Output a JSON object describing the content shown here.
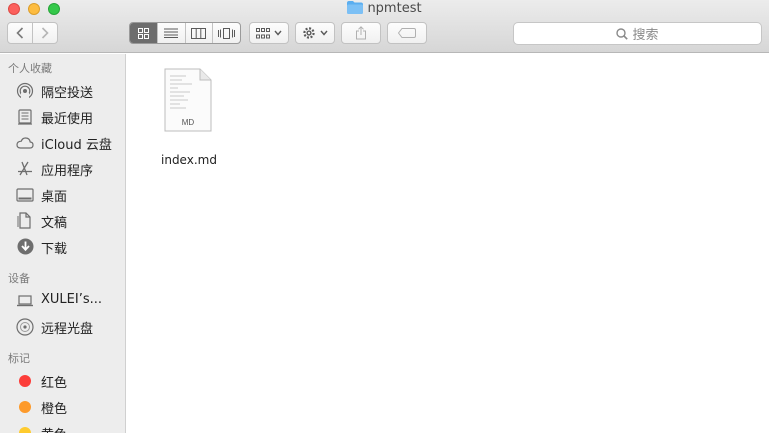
{
  "window": {
    "title": "npmtest"
  },
  "toolbar": {
    "search_placeholder": "搜索",
    "view_modes": [
      "icon-view",
      "list-view",
      "column-view",
      "cover-flow-view"
    ]
  },
  "sidebar": {
    "sections": [
      {
        "title": "个人收藏",
        "items": [
          {
            "label": "隔空投送",
            "icon": "airdrop-icon"
          },
          {
            "label": "最近使用",
            "icon": "recents-icon"
          },
          {
            "label": "iCloud 云盘",
            "icon": "cloud-icon"
          },
          {
            "label": "应用程序",
            "icon": "applications-icon"
          },
          {
            "label": "桌面",
            "icon": "desktop-icon"
          },
          {
            "label": "文稿",
            "icon": "documents-icon"
          },
          {
            "label": "下载",
            "icon": "downloads-icon"
          }
        ]
      },
      {
        "title": "设备",
        "items": [
          {
            "label": "XULEI’s...",
            "icon": "laptop-icon"
          },
          {
            "label": "远程光盘",
            "icon": "disc-icon"
          }
        ]
      },
      {
        "title": "标记",
        "items": [
          {
            "label": "红色",
            "color": "#fc3d39"
          },
          {
            "label": "橙色",
            "color": "#fd9a2b"
          },
          {
            "label": "黄色",
            "color": "#fecb2f"
          }
        ]
      }
    ]
  },
  "files": [
    {
      "name": "index.md",
      "type_badge": "MD"
    }
  ]
}
